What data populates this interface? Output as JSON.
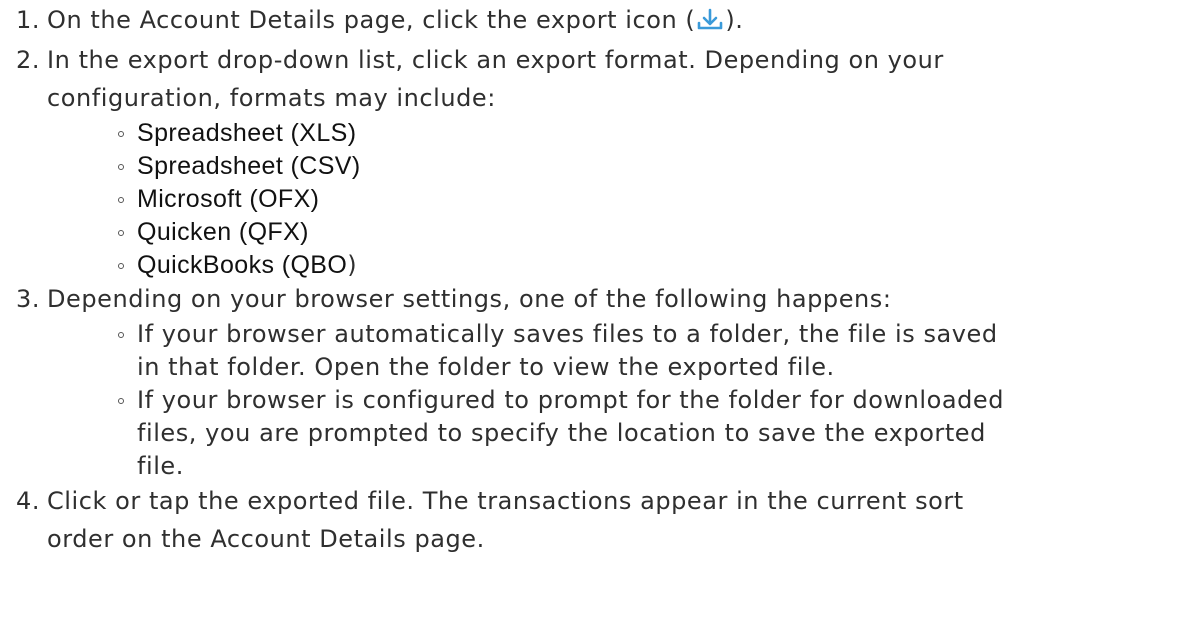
{
  "colors": {
    "text": "#2f2f2f",
    "format_text": "#111111",
    "export_icon": "#3a9ad9"
  },
  "steps": [
    {
      "number": "1.",
      "before_icon": "On the Account Details page, click the export icon (",
      "icon": "download-icon",
      "after_icon": ")."
    },
    {
      "number": "2.",
      "lines": [
        "In the export drop-down list, click an export format. Depending on your",
        "configuration, formats may include:"
      ],
      "formats": [
        "Spreadsheet (XLS)",
        "Spreadsheet (CSV)",
        "Microsoft (OFX)",
        "Quicken (QFX)",
        "QuickBooks (QBO)"
      ],
      "formats_closing_paren": ")"
    },
    {
      "number": "3.",
      "text": "Depending on your browser settings, one of the following happens:",
      "items": [
        {
          "lines": [
            "If your browser automatically saves files to a folder, the file is saved",
            "in that folder. Open the folder to view the exported file."
          ]
        },
        {
          "lines": [
            "If your browser is configured to prompt for the folder for downloaded",
            "files, you are prompted to specify the location to save the exported",
            "file."
          ]
        }
      ]
    },
    {
      "number": "4.",
      "lines": [
        "Click or tap the exported file. The transactions appear in the current sort",
        "order on the Account Details page."
      ]
    }
  ]
}
